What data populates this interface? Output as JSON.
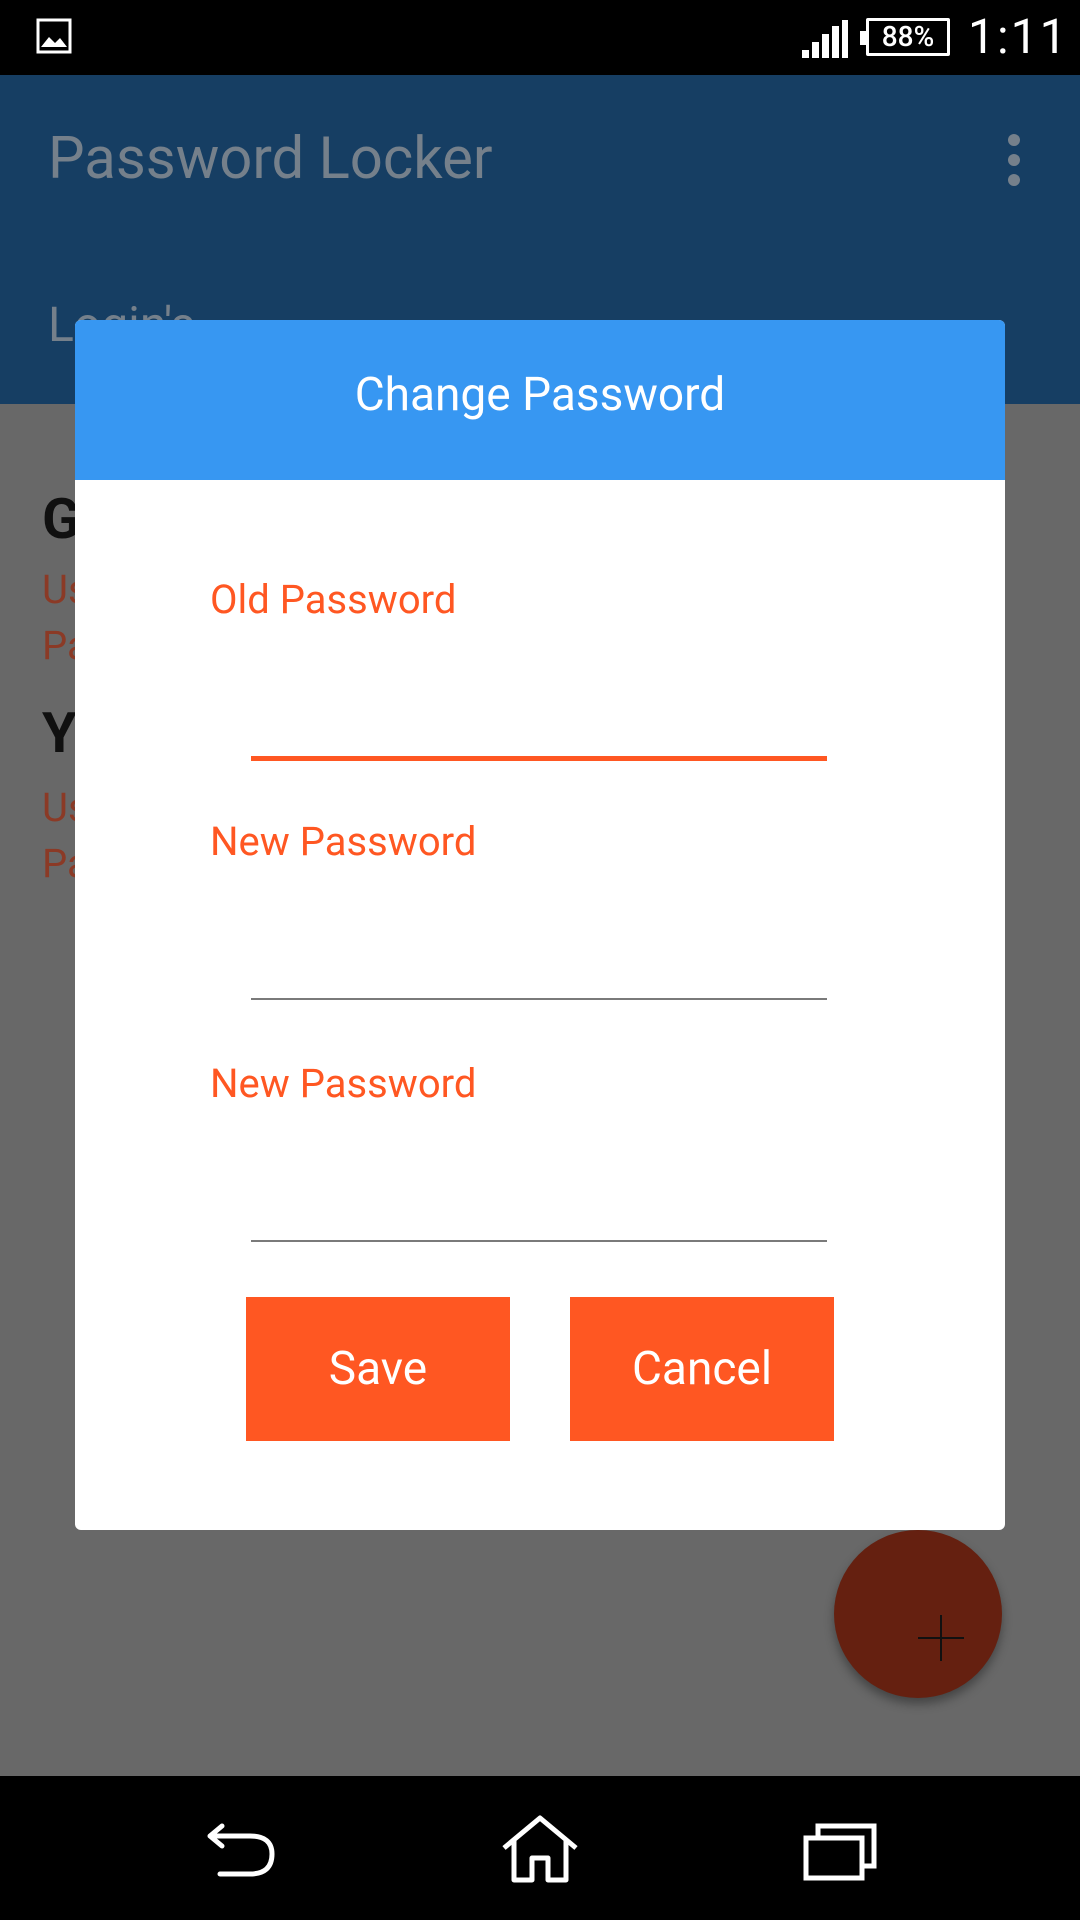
{
  "status_bar": {
    "battery": "88%",
    "time": "1:11"
  },
  "app_bar": {
    "title": "Password Locker",
    "tab": "Login's"
  },
  "background_entries": [
    {
      "initial": "G",
      "username_prefix": "Us",
      "password_prefix": "Pa"
    },
    {
      "initial": "Y",
      "username_prefix": "Us",
      "password_prefix": "Pa"
    }
  ],
  "dialog": {
    "title": "Change Password",
    "fields": [
      {
        "label": "Old Password",
        "value": ""
      },
      {
        "label": "New Password",
        "value": ""
      },
      {
        "label": "New Password",
        "value": ""
      }
    ],
    "save_label": "Save",
    "cancel_label": "Cancel"
  },
  "colors": {
    "dialog_header": "#3797f2",
    "accent": "#ff5722",
    "app_bar_dimmed": "#163e63"
  },
  "icons": {
    "status_left": "gallery-icon",
    "app_menu": "overflow-menu-icon",
    "fab": "add-icon",
    "nav": [
      "back-icon",
      "home-icon",
      "recent-apps-icon"
    ]
  }
}
